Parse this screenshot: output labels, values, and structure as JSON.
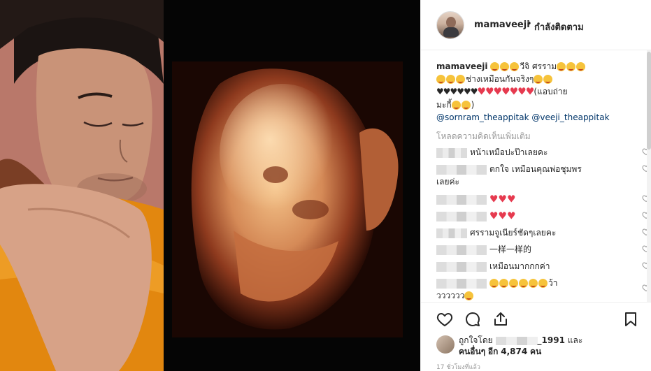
{
  "post": {
    "username": "mamaveeji",
    "separator": "•",
    "follow_status": "กำลังติดตาม",
    "caption": {
      "username": "mamaveeji",
      "line1_text": "วีจิ ศรราม",
      "line2_text": "ช่างเหมือนกันจริงๆ",
      "line3_text": "(แอบถ่าย",
      "line4_text": "มะกี้",
      "mention1": "@sornram_theappitak",
      "mention2": "@veeji_theappitak"
    },
    "load_more": "โหลดความคิดเห็นเพิ่มเติม",
    "comments": [
      {
        "text": "หน้าเหมือปะป๊าเลยคะ"
      },
      {
        "text": "ตกใจ เหมือนคุณพ่อชุมพร",
        "text2": "เลยค่ะ"
      },
      {
        "text": ""
      },
      {
        "text": ""
      },
      {
        "text": "ศรรามจูเนียร์ชัดๆเลยคะ"
      },
      {
        "text": "一样一样的"
      },
      {
        "text": "เหมือนมากกกค่า"
      },
      {
        "text": "ว้า",
        "text2": "วววววว"
      }
    ],
    "likes": {
      "prefix": "ถูกใจโดย",
      "user_suffix": "_1991",
      "and": "และ",
      "others_label": "คนอื่นๆ",
      "others_extra": "อีก",
      "count": "4,874",
      "unit": "คน"
    },
    "timestamp": "17 ชั่วโมงที่แล้ว"
  },
  "icons": {
    "like": "heart-outline-icon",
    "comment": "comment-bubble-icon",
    "share": "share-arrow-icon",
    "save": "bookmark-icon"
  }
}
